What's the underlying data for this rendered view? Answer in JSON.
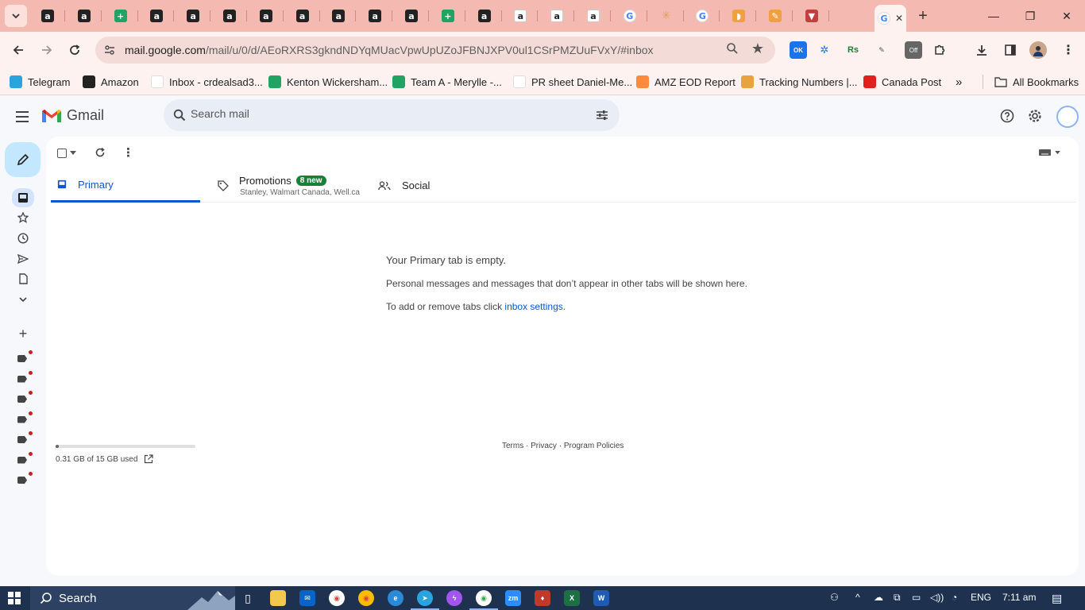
{
  "browser": {
    "tabs": [
      {
        "icon": "amazon",
        "glyph": "a"
      },
      {
        "icon": "amazon",
        "glyph": "a"
      },
      {
        "icon": "sheets",
        "glyph": "+"
      },
      {
        "icon": "amazon",
        "glyph": "a"
      },
      {
        "icon": "amazon",
        "glyph": "a"
      },
      {
        "icon": "amazon",
        "glyph": "a"
      },
      {
        "icon": "amazon",
        "glyph": "a"
      },
      {
        "icon": "amazon",
        "glyph": "a"
      },
      {
        "icon": "amazon",
        "glyph": "a"
      },
      {
        "icon": "amazon",
        "glyph": "a"
      },
      {
        "icon": "amazon",
        "glyph": "a"
      },
      {
        "icon": "sheets",
        "glyph": "+"
      },
      {
        "icon": "amazon",
        "glyph": "a"
      },
      {
        "icon": "amazon-white",
        "glyph": "a"
      },
      {
        "icon": "amazon-white",
        "glyph": "a"
      },
      {
        "icon": "amazon-white",
        "glyph": "a"
      },
      {
        "icon": "google",
        "glyph": "G"
      },
      {
        "icon": "star",
        "glyph": "✳"
      },
      {
        "icon": "google",
        "glyph": "G"
      },
      {
        "icon": "taco",
        "glyph": "◗"
      },
      {
        "icon": "pencil",
        "glyph": "✎"
      },
      {
        "icon": "tally",
        "glyph": "▼"
      }
    ],
    "active_tab_icon": "google",
    "active_tab_close": "✕",
    "new_tab": "+",
    "window_controls": {
      "minimize": "—",
      "restore": "❐",
      "close": "✕"
    },
    "url": {
      "host": "mail.google.com",
      "path": "/mail/u/0/d/AEoRXRS3gkndNDYqMUacVpwUpUZoJFBNJXPV0ul1CSrPMZUuFVxY/#inbox"
    },
    "bookmarks": [
      {
        "label": "Telegram",
        "icon": "telegram",
        "color": "#2aa3df"
      },
      {
        "label": "Amazon",
        "icon": "amazon",
        "color": "#222222"
      },
      {
        "label": "Inbox - crdealsad3...",
        "icon": "gmail",
        "color": "#ffffff"
      },
      {
        "label": "Kenton Wickersham...",
        "icon": "sheets",
        "color": "#1fa463"
      },
      {
        "label": "Team A - Merylle -...",
        "icon": "sheets",
        "color": "#1fa463"
      },
      {
        "label": "PR sheet Daniel-Me...",
        "icon": "google",
        "color": "#ffffff"
      },
      {
        "label": "AMZ EOD Report",
        "icon": "pencil",
        "color": "#ff8a3d"
      },
      {
        "label": "Tracking Numbers |...",
        "icon": "taco",
        "color": "#e8a33d"
      },
      {
        "label": "Canada Post",
        "icon": "canada-post",
        "color": "#e0201b"
      }
    ],
    "more_bookmarks": "»",
    "all_bookmarks": "All Bookmarks"
  },
  "gmail": {
    "logo_text": "Gmail",
    "search_placeholder": "Search mail",
    "tabs": {
      "primary": "Primary",
      "promotions": "Promotions",
      "promotions_badge": "8 new",
      "promotions_senders": "Stanley, Walmart Canada, Well.ca",
      "social": "Social"
    },
    "empty": {
      "title": "Your Primary tab is empty.",
      "line1": "Personal messages and messages that don’t appear in other tabs will be shown here.",
      "line2_prefix": "To add or remove tabs click ",
      "line2_link": "inbox settings",
      "line2_suffix": "."
    },
    "storage": {
      "text": "0.31 GB of 15 GB used",
      "fraction_used": 0.021
    },
    "footer": {
      "terms": "Terms",
      "sep": " · ",
      "privacy": "Privacy",
      "policies": "Program Policies"
    }
  },
  "taskbar": {
    "search": "Search",
    "lang": "ENG",
    "time": "7:11 am"
  },
  "colors": {
    "tabstrip": "#f4b9b0",
    "toolbar": "#fdf2f0",
    "gmail_bg": "#f6f8fc",
    "compose": "#c2e7ff",
    "primary_accent": "#0b57d0",
    "badge_green": "#188038",
    "label_dot": "#c5221f",
    "taskbar": "#1e3250"
  }
}
